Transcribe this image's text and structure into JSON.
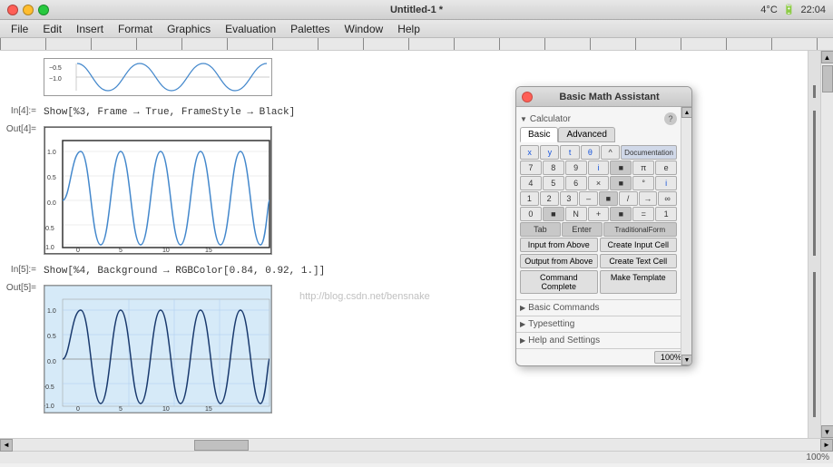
{
  "titleBar": {
    "title": "Untitled-1 *",
    "statusRight": "4°C",
    "time": "22:04"
  },
  "menuBar": {
    "items": [
      "File",
      "Edit",
      "Insert",
      "Format",
      "Graphics",
      "Evaluation",
      "Palettes",
      "Window",
      "Help"
    ]
  },
  "notebook": {
    "cells": [
      {
        "inputLabel": "In[4]:=",
        "inputCode": "Show[%3, Frame → True, FrameStyle → Black]",
        "outputLabel": "Out[4]="
      },
      {
        "inputLabel": "In[5]:=",
        "inputCode": "Show[%4, Background → RGBColor[0.84, 0.92, 1.]]",
        "outputLabel": "Out[5]="
      }
    ]
  },
  "panel": {
    "title": "Basic Math Assistant",
    "calculatorLabel": "Calculator",
    "helpIcon": "?",
    "tabs": [
      "Basic",
      "Advanced"
    ],
    "activeTab": "Basic",
    "rows": [
      [
        "x",
        "y",
        "t",
        "θ",
        "^",
        "Documentation"
      ],
      [
        "7",
        "8",
        "9",
        "i",
        "■",
        "π",
        "e"
      ],
      [
        "4",
        "5",
        "6",
        "×",
        "■",
        "°",
        "i"
      ],
      [
        "1",
        "2",
        "3",
        "–",
        "■",
        "/",
        "→",
        "∞"
      ],
      [
        "0",
        "■",
        "N",
        "+",
        "■",
        "=",
        "1"
      ]
    ],
    "specialBtns": [
      "Tab",
      "Enter",
      "TraditionalForm"
    ],
    "actionBtns": [
      "Input from Above",
      "Create Input Cell",
      "Output from Above",
      "Create Text Cell",
      "Command Complete",
      "Make Template"
    ],
    "sections": [
      {
        "label": "Basic Commands",
        "open": false
      },
      {
        "label": "Typesetting",
        "open": false
      },
      {
        "label": "Help and Settings",
        "open": false
      }
    ],
    "zoom": "100%"
  },
  "watermark": "http://blog.csdn.net/bensnake",
  "statusBar": {
    "left": "",
    "right": "100%"
  }
}
